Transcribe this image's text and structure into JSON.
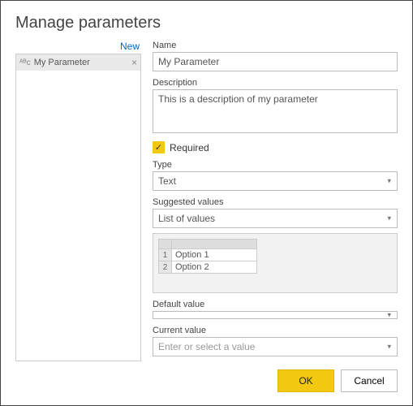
{
  "title": "Manage parameters",
  "sidebar": {
    "new_link": "New",
    "params": [
      {
        "label": "My Parameter",
        "icon": "ᴬᴮc"
      }
    ]
  },
  "form": {
    "name_label": "Name",
    "name_value": "My Parameter",
    "desc_label": "Description",
    "desc_value": "This is a description of my parameter",
    "required_label": "Required",
    "type_label": "Type",
    "type_value": "Text",
    "suggested_label": "Suggested values",
    "suggested_value": "List of values",
    "list_rows": [
      {
        "n": "1",
        "v": "Option 1"
      },
      {
        "n": "2",
        "v": "Option 2"
      }
    ],
    "default_label": "Default value",
    "default_value": "",
    "current_label": "Current value",
    "current_placeholder": "Enter or select a value"
  },
  "footer": {
    "ok": "OK",
    "cancel": "Cancel"
  }
}
